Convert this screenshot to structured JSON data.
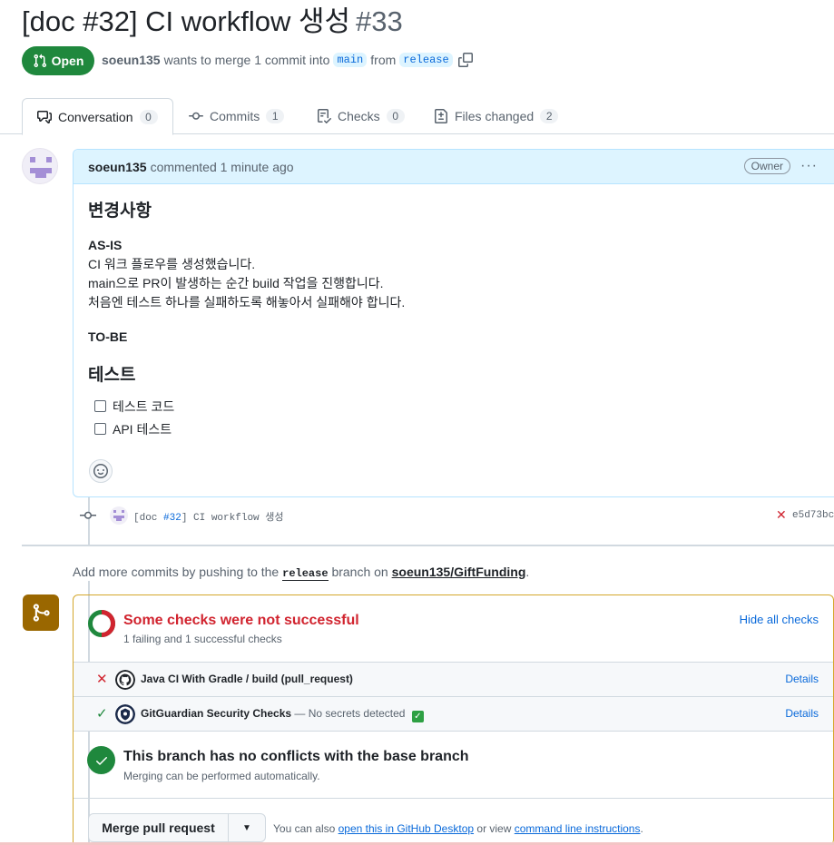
{
  "pr": {
    "title": "[doc #32] CI workflow 생성",
    "number": "#33",
    "state": "Open",
    "author": "soeun135",
    "merge_text": "wants to merge 1 commit into",
    "base_branch": "main",
    "from_text": "from",
    "head_branch": "release"
  },
  "tabs": [
    {
      "label": "Conversation",
      "count": "0"
    },
    {
      "label": "Commits",
      "count": "1"
    },
    {
      "label": "Checks",
      "count": "0"
    },
    {
      "label": "Files changed",
      "count": "2"
    }
  ],
  "comment": {
    "author": "soeun135",
    "meta": "commented 1 minute ago",
    "badge": "Owner",
    "more": "···",
    "heading1": "변경사항",
    "asis_label": "AS-IS",
    "lines": [
      "CI 워크 플로우를 생성했습니다.",
      "main으로 PR이 발생하는 순간 build 작업을 진행합니다.",
      "처음엔 테스트 하나를 실패하도록 해놓아서 실패해야 합니다."
    ],
    "tobe_label": "TO-BE",
    "heading2": "테스트",
    "tasks": [
      "테스트 코드",
      "API 테스트"
    ]
  },
  "commit": {
    "prefix": "[doc ",
    "issue": "#32",
    "suffix": "] CI workflow 생성",
    "sha": "e5d73bc"
  },
  "add_more": {
    "before": "Add more commits by pushing to the",
    "branch": "release",
    "middle": "branch on",
    "repo": "soeun135/GiftFunding",
    "end": "."
  },
  "checks": {
    "title": "Some checks were not successful",
    "subtitle": "1 failing and 1 successful checks",
    "hide_label": "Hide all checks",
    "items": [
      {
        "name": "Java CI With Gradle / build (pull_request)",
        "desc": "",
        "details": "Details",
        "status": "fail"
      },
      {
        "name": "GitGuardian Security Checks",
        "desc": "— No secrets detected",
        "details": "Details",
        "status": "pass"
      }
    ]
  },
  "conflicts": {
    "title": "This branch has no conflicts with the base branch",
    "subtitle": "Merging can be performed automatically."
  },
  "merge": {
    "button": "Merge pull request",
    "hint_before": "You can also",
    "hint_link1": "open this in GitHub Desktop",
    "hint_middle": "or view",
    "hint_link2": "command line instructions",
    "hint_end": "."
  },
  "colors": {
    "open_green": "#1f883d",
    "fail_red": "#d1242f",
    "link_blue": "#0969da",
    "warning_brown": "#9a6700"
  }
}
